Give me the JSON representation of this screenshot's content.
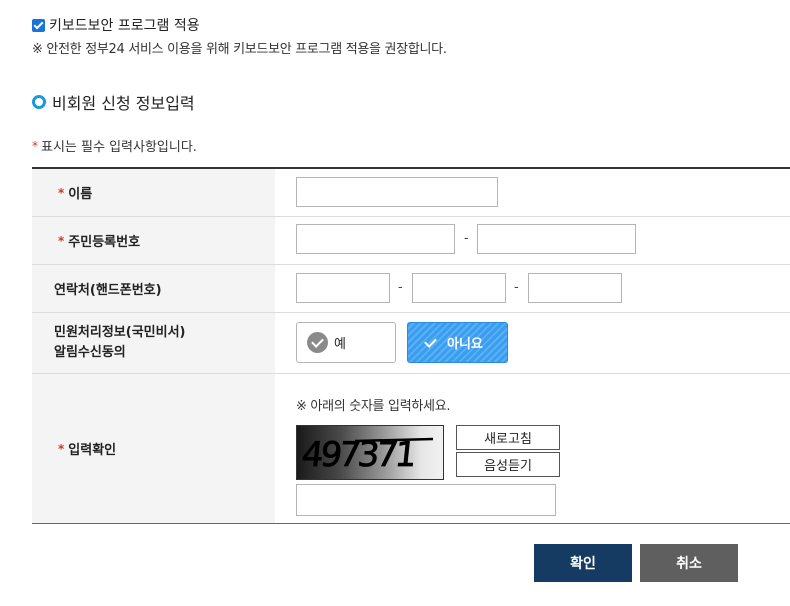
{
  "keyboard_security": {
    "checked": true,
    "label": "키보드보안 프로그램 적용",
    "note": "※ 안전한 정부24 서비스 이용을 위해 키보드보안 프로그램 적용을 권장합니다."
  },
  "section": {
    "title": "비회원 신청 정보입력",
    "required_marker": "*",
    "required_note": "표시는 필수 입력사항입니다."
  },
  "form": {
    "name_label": "이름",
    "resident_label": "주민등록번호",
    "phone_label": "연락처(핸드폰번호)",
    "dash": "-",
    "consent_label_line1": "민원처리정보(국민비서)",
    "consent_label_line2": "알림수신동의",
    "consent_yes": "예",
    "consent_no": "아니요",
    "consent_selected": "아니요",
    "captcha_label": "입력확인",
    "captcha_note": "※ 아래의 숫자를 입력하세요.",
    "captcha_text": "497371",
    "refresh_label": "새로고침",
    "audio_label": "음성듣기"
  },
  "buttons": {
    "confirm": "확인",
    "cancel": "취소"
  },
  "colors": {
    "accent": "#1a73d9",
    "required": "#d9342b",
    "confirm_bg": "#163b63",
    "cancel_bg": "#5f5f5f",
    "selected_bg": "#3a9ef0"
  }
}
